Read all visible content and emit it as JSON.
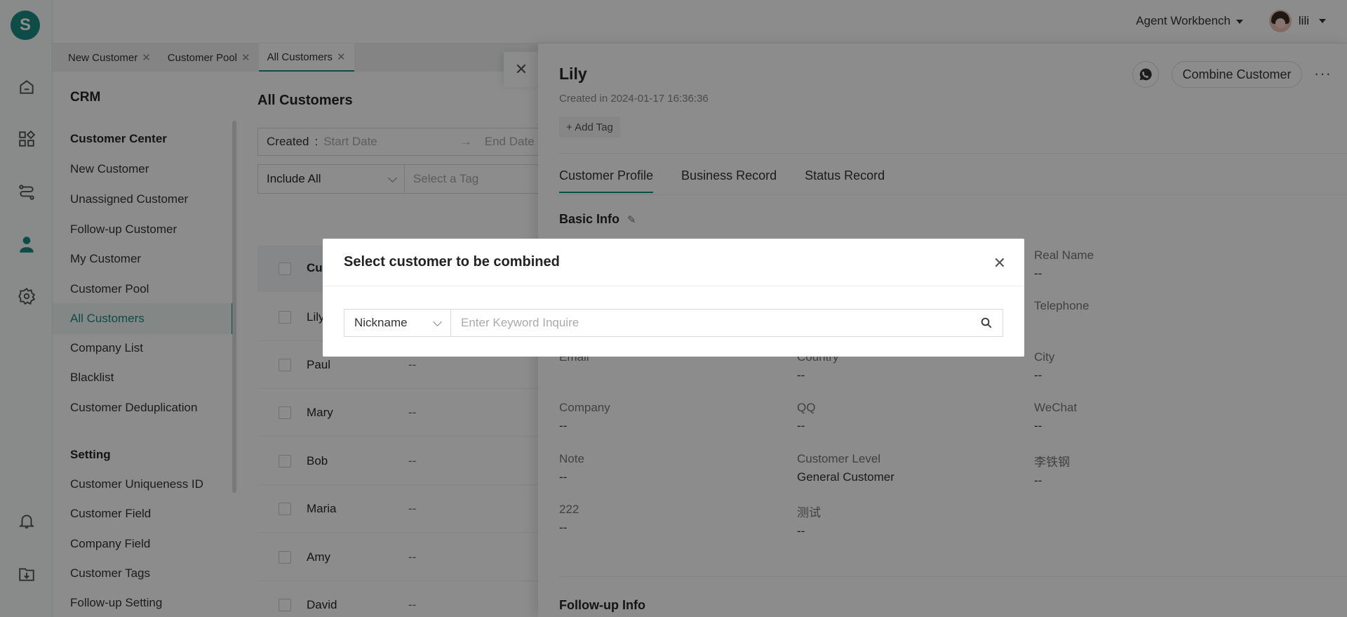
{
  "app": {
    "logo": "S"
  },
  "header": {
    "workbench": "Agent Workbench",
    "user": "lili"
  },
  "tabs": [
    {
      "label": "New Customer",
      "close": "✕"
    },
    {
      "label": "Customer Pool",
      "close": "✕"
    },
    {
      "label": "All Customers",
      "close": "✕"
    }
  ],
  "sidebar": {
    "title": "CRM",
    "group1": "Customer Center",
    "items1": [
      "New Customer",
      "Unassigned Customer",
      "Follow-up Customer",
      "My Customer",
      "Customer Pool",
      "All Customers",
      "Company List",
      "Blacklist",
      "Customer Deduplication"
    ],
    "group2": "Setting",
    "items2": [
      "Customer Uniqueness ID",
      "Customer Field",
      "Company Field",
      "Customer Tags",
      "Follow-up Setting"
    ]
  },
  "list": {
    "title": "All Customers",
    "created_label": "Created",
    "start_placeholder": "Start Date",
    "end_placeholder": "End Date",
    "arrow": "→",
    "include_all": "Include All",
    "tag_placeholder": "Select a Tag",
    "header_partial": "Cu",
    "rows": [
      {
        "name": "Lily",
        "val": ""
      },
      {
        "name": "Paul",
        "val": "--"
      },
      {
        "name": "Mary",
        "val": "--"
      },
      {
        "name": "Bob",
        "val": "--"
      },
      {
        "name": "Maria",
        "val": "--"
      },
      {
        "name": "Amy",
        "val": "--"
      },
      {
        "name": "David",
        "val": "--"
      }
    ]
  },
  "detail": {
    "name": "Lily",
    "created": "Created in 2024-01-17 16:36:36",
    "add_tag": "+ Add Tag",
    "combine": "Combine Customer",
    "more": "···",
    "tabs": [
      "Customer Profile",
      "Business Record",
      "Status Record"
    ],
    "basic_info": "Basic Info",
    "followup_info": "Follow-up Info",
    "fields": {
      "real_name": {
        "label": "Real Name",
        "value": "--"
      },
      "telephone": {
        "label": "Telephone",
        "value": ""
      },
      "email": {
        "label": "Email",
        "value": ""
      },
      "country": {
        "label": "Country",
        "value": "--"
      },
      "city": {
        "label": "City",
        "value": "--"
      },
      "company": {
        "label": "Company",
        "value": "--"
      },
      "qq": {
        "label": "QQ",
        "value": "--"
      },
      "wechat": {
        "label": "WeChat",
        "value": "--"
      },
      "note": {
        "label": "Note",
        "value": "--"
      },
      "level": {
        "label": "Customer Level",
        "value": "General Customer"
      },
      "cn_name": {
        "label": "李铁钢",
        "value": "--"
      },
      "f222": {
        "label": "222",
        "value": "--"
      },
      "test": {
        "label": "测试",
        "value": "--"
      }
    }
  },
  "modal": {
    "title": "Select customer to be combined",
    "close": "✕",
    "select_value": "Nickname",
    "input_placeholder": "Enter Keyword Inquire"
  },
  "drawer_close": "✕",
  "colors": {
    "accent": "#1a8a83"
  }
}
